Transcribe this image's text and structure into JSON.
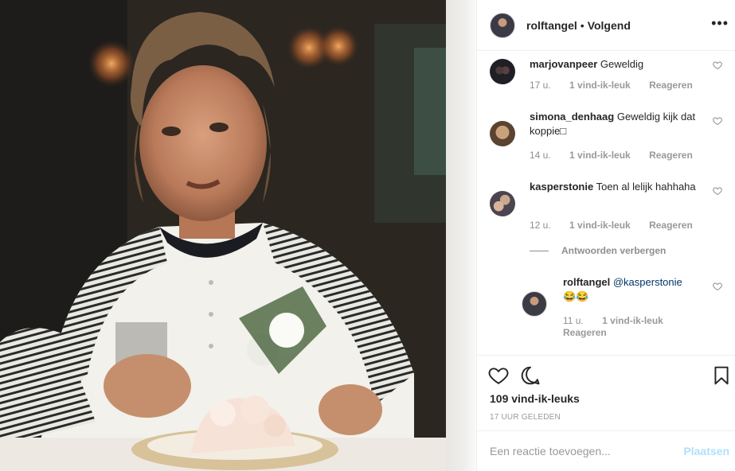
{
  "header": {
    "username": "rolftangel",
    "separator": "•",
    "follow_label": "Volgend",
    "more_icon": "more-options-icon"
  },
  "comments": [
    {
      "username": "marjovanpeer",
      "text": "Geweldig",
      "time": "17 u.",
      "likes": "1 vind-ik-leuk",
      "reply": "Reageren"
    },
    {
      "username": "simona_denhaag",
      "text": "Geweldig kijk dat koppie□",
      "time": "14 u.",
      "likes": "1 vind-ik-leuk",
      "reply": "Reageren"
    },
    {
      "username": "kasperstonie",
      "text": "Toen al lelijk hahhaha",
      "time": "12 u.",
      "likes": "1 vind-ik-leuk",
      "reply": "Reageren"
    }
  ],
  "hide_replies": "Antwoorden verbergen",
  "reply": {
    "username": "rolftangel",
    "mention": "@kasperstonie",
    "text": "😂😂",
    "time": "11 u.",
    "likes": "1 vind-ik-leuk",
    "reply": "Reageren"
  },
  "actions": {
    "like_icon": "heart-icon",
    "comment_icon": "comment-icon",
    "save_icon": "bookmark-icon",
    "likes_count": "109 vind-ik-leuks",
    "posted_ago": "17 UUR GELEDEN"
  },
  "add_comment": {
    "placeholder": "Een reactie toevoegen...",
    "post_label": "Plaatsen"
  },
  "colors": {
    "link": "#003569",
    "muted": "#8e8e8e",
    "post_disabled": "#b2dffc",
    "border": "#efefef"
  }
}
